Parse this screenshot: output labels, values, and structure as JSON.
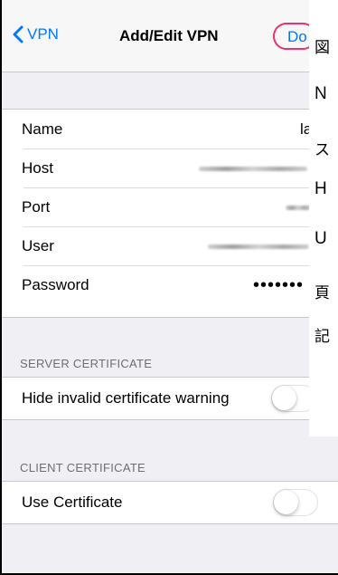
{
  "nav": {
    "back_label": "VPN",
    "title": "Add/Edit VPN",
    "done_label": "Do"
  },
  "fields": [
    {
      "label": "Name",
      "value": "la"
    },
    {
      "label": "Host"
    },
    {
      "label": "Port"
    },
    {
      "label": "User"
    },
    {
      "label": "Password",
      "value": "•••••••"
    }
  ],
  "server_certificate": {
    "header": "SERVER CERTIFICATE",
    "hide_warning_label": "Hide invalid certificate warning",
    "hide_warning_on": false
  },
  "client_certificate": {
    "header": "CLIENT CERTIFICATE",
    "use_label": "Use Certificate",
    "use_on": false
  },
  "overlay_text": [
    "図",
    "N",
    "ス",
    "H",
    "U",
    "頁",
    "記"
  ],
  "colors": {
    "accent": "#007aff",
    "annotation": "#e8336b",
    "background": "#efeff4"
  },
  "icons": {
    "back": "chevron-left-icon"
  }
}
